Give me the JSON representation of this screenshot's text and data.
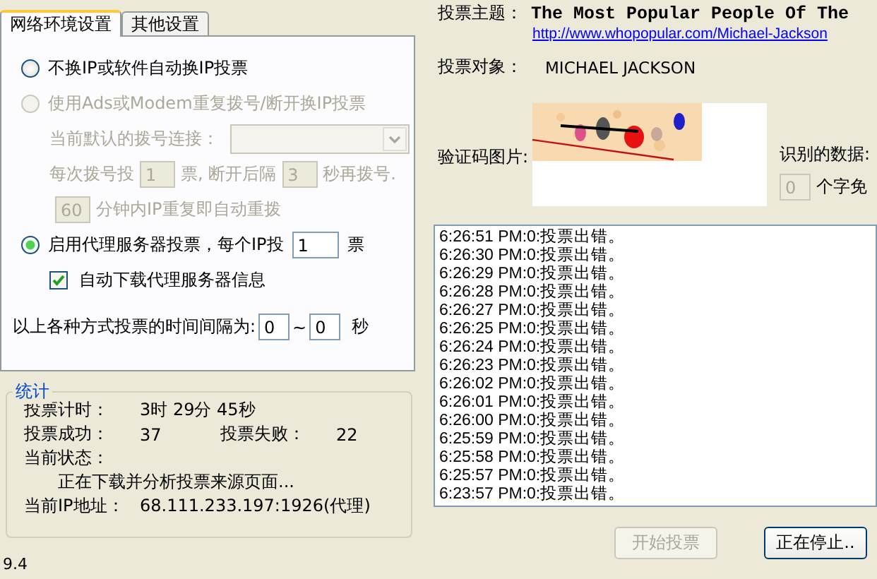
{
  "tabs": [
    {
      "label": "网络环境设置",
      "selected": true
    },
    {
      "label": "其他设置",
      "selected": false
    }
  ],
  "network_settings": {
    "no_change_ip": {
      "label": "不换IP或软件自动换IP投票",
      "selected": false
    },
    "dialup": {
      "label": "使用Ads或Modem重复拨号/断开换IP投票",
      "selected": false,
      "disabled": true,
      "connection_label": "当前默认的拨号连接：",
      "votes_before": "每次拨号投",
      "votes_value": "1",
      "votes_after": "票, 断开后隔",
      "wait_value": "3",
      "wait_after": "秒再拨号.",
      "redial_value": "60",
      "redial_after": "分钟内IP重复即自动重拨"
    },
    "proxy": {
      "label": "启用代理服务器投票，每个IP投",
      "selected": true,
      "votes_value": "1",
      "votes_after": "票",
      "auto_download": {
        "label": "自动下载代理服务器信息",
        "checked": true
      }
    },
    "interval": {
      "label": "以上各种方式投票的时间间隔为:",
      "from": "0",
      "separator": "~",
      "to": "0",
      "unit": "秒"
    }
  },
  "statistics": {
    "title": "统计",
    "timer_label": "投票计时：",
    "timer_value": "3时 29分 45秒",
    "success_label": "投票成功：",
    "success_value": "37",
    "fail_label": "投票失败：",
    "fail_value": "22",
    "status_label": "当前状态：",
    "status_value": "正在下载并分析投票来源页面...",
    "ip_label": "当前IP地址：",
    "ip_value": "68.111.233.197:1926(代理)"
  },
  "version": "9.4",
  "vote": {
    "topic_label": "投票主题：",
    "topic": "The Most Popular People Of The",
    "url": "http://www.whopopular.com/Michael-Jackson",
    "target_label": "投票对象：",
    "target": "MICHAEL JACKSON",
    "captcha_label": "验证码图片:",
    "recognized_label": "识别的数据:",
    "ignore_value": "0",
    "ignore_after": "个字免"
  },
  "log": [
    "6:26:51 PM:0:投票出错。",
    "6:26:30 PM:0:投票出错。",
    "6:26:29 PM:0:投票出错。",
    "6:26:28 PM:0:投票出错。",
    "6:26:27 PM:0:投票出错。",
    "6:26:25 PM:0:投票出错。",
    "6:26:24 PM:0:投票出错。",
    "6:26:23 PM:0:投票出错。",
    "6:26:02 PM:0:投票出错。",
    "6:26:01 PM:0:投票出错。",
    "6:26:00 PM:0:投票出错。",
    "6:25:59 PM:0:投票出错。",
    "6:25:58 PM:0:投票出错。",
    "6:25:57 PM:0:投票出错。",
    "6:23:57 PM:0:投票出错。"
  ],
  "buttons": [
    {
      "label": "开始投票",
      "disabled": true
    },
    {
      "label": "正在停止..",
      "disabled": false
    }
  ]
}
